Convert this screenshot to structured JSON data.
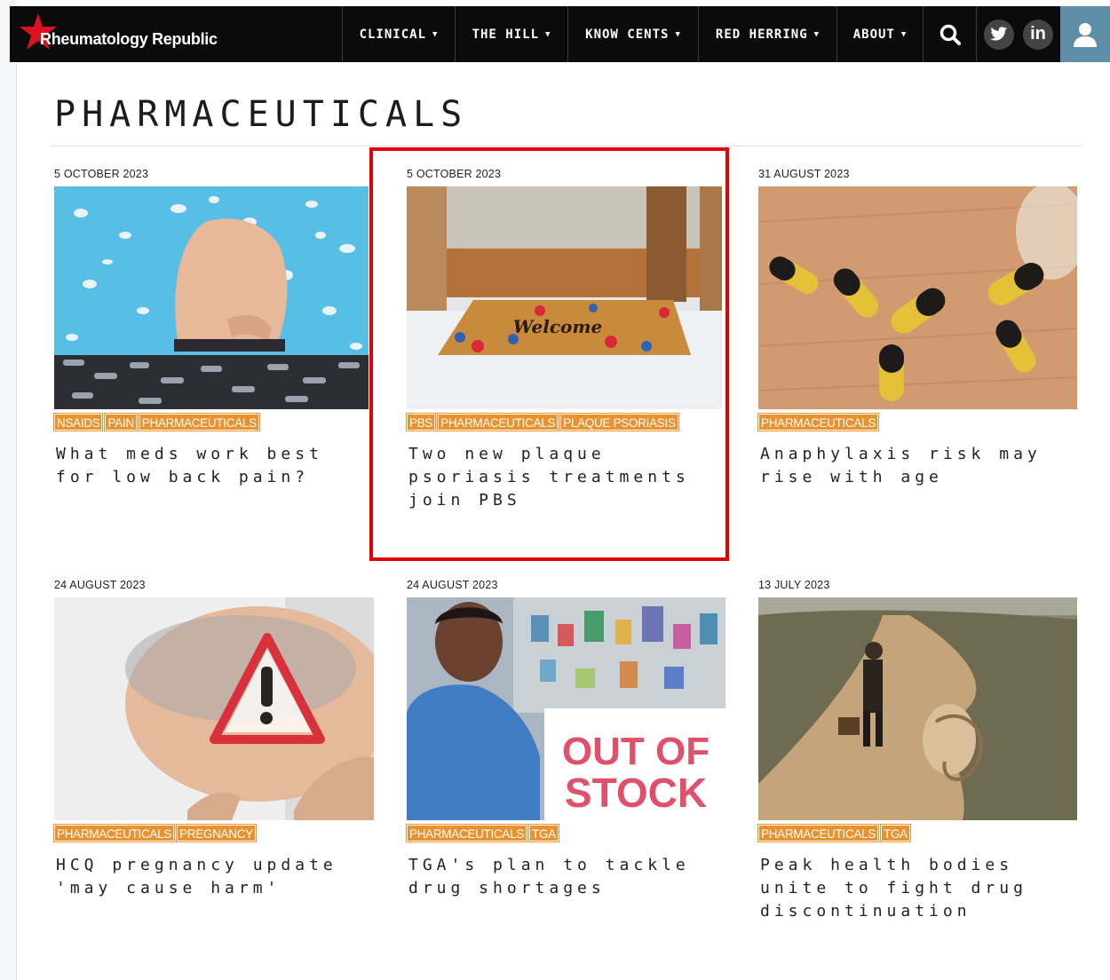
{
  "site": {
    "name": "Rheumatology Republic",
    "brand_red": "#d9131f",
    "accent_orange": "#e8932f"
  },
  "nav": {
    "items": [
      {
        "label": "CLINICAL"
      },
      {
        "label": "THE HILL"
      },
      {
        "label": "KNOW CENTS"
      },
      {
        "label": "RED HERRING"
      },
      {
        "label": "ABOUT"
      }
    ],
    "icons": [
      "search-icon",
      "twitter-icon",
      "linkedin-icon",
      "user-icon"
    ],
    "linkedin_glyph": "in"
  },
  "page": {
    "title": "PHARMACEUTICALS"
  },
  "articles": [
    {
      "date": "5 OCTOBER 2023",
      "tags": [
        "NSAIDS",
        "PAIN",
        "PHARMACEUTICALS"
      ],
      "title": "What meds work best for low back pain?"
    },
    {
      "date": "5 OCTOBER 2023",
      "tags": [
        "PBS",
        "PHARMACEUTICALS",
        "PLAQUE PSORIASIS"
      ],
      "title": "Two new plaque psoriasis treatments join PBS"
    },
    {
      "date": "31 AUGUST 2023",
      "tags": [
        "PHARMACEUTICALS"
      ],
      "title": "Anaphylaxis risk may rise with age"
    },
    {
      "date": "24 AUGUST 2023",
      "tags": [
        "PHARMACEUTICALS",
        "PREGNANCY"
      ],
      "title": "HCQ pregnancy update 'may cause harm'"
    },
    {
      "date": "24 AUGUST 2023",
      "tags": [
        "PHARMACEUTICALS",
        "TGA"
      ],
      "title": "TGA's plan to tackle drug shortages"
    },
    {
      "date": "13 JULY 2023",
      "tags": [
        "PHARMACEUTICALS",
        "TGA"
      ],
      "title": "Peak health bodies unite to fight drug discontinuation"
    }
  ],
  "image_text": {
    "out_of_stock_line1": "OUT OF",
    "out_of_stock_line2": "STOCK",
    "welcome": "Welcome"
  }
}
